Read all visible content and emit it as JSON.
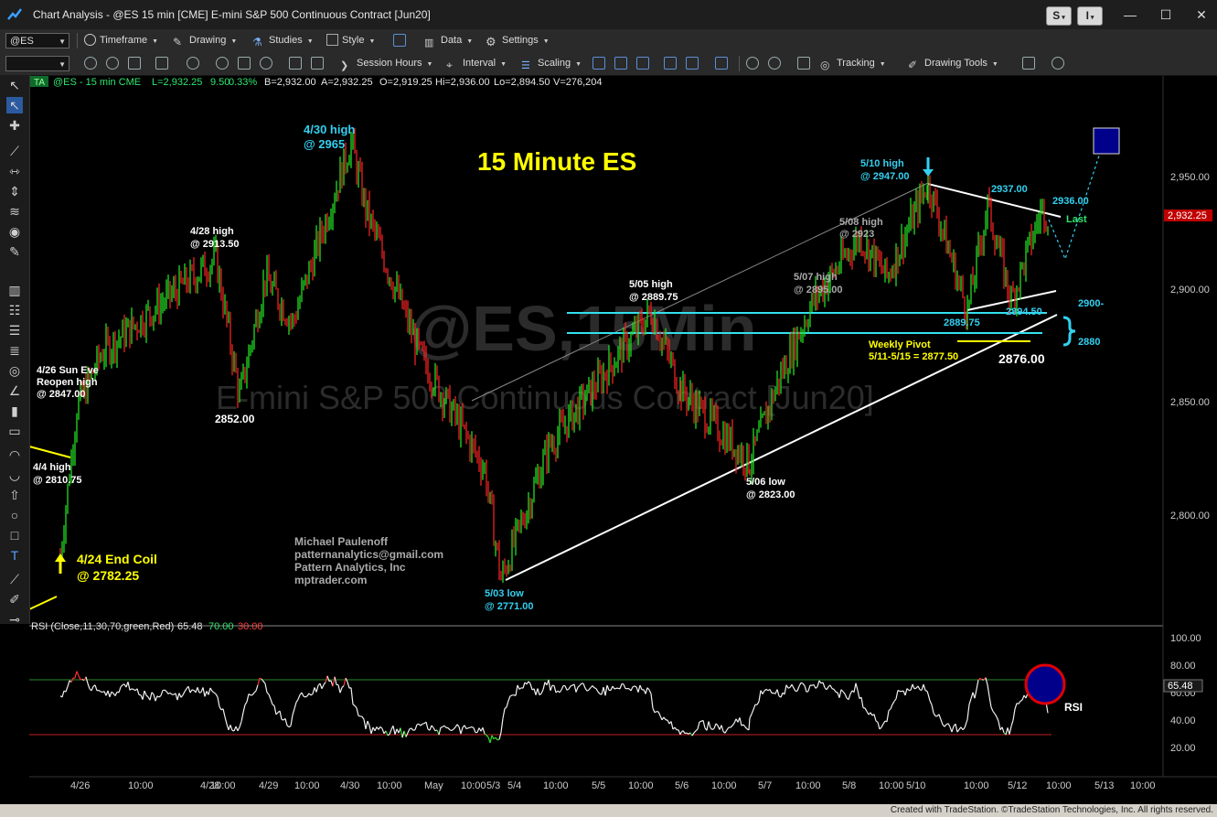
{
  "window": {
    "title": "Chart Analysis - @ES 15 min [CME] E-mini S&P 500 Continuous Contract [Jun20]",
    "btn_s": "S",
    "btn_i": "I"
  },
  "toolbar1": {
    "symbol": "@ES",
    "timeframe": "Timeframe",
    "drawing": "Drawing",
    "studies": "Studies",
    "style": "Style",
    "data": "Data",
    "settings": "Settings"
  },
  "toolbar2": {
    "session_hours": "Session Hours",
    "interval": "Interval",
    "scaling": "Scaling",
    "tracking": "Tracking",
    "drawing_tools": "Drawing Tools"
  },
  "header": {
    "badge": "TA",
    "symbol_info": "@ES - 15 min  CME",
    "last": "L=2,932.25",
    "change": "9.50",
    "pct": "0.33%",
    "bid": "B=2,932.00",
    "ask": "A=2,932.25",
    "open": "O=2,919.25",
    "high": "Hi=2,936.00",
    "low": "Lo=2,894.50",
    "volume": "V=276,204"
  },
  "watermark": {
    "symbol": "@ES,15Min",
    "name": "E-mini S&P 500 Continuous Contract [Jun20]"
  },
  "chart_title": "15 Minute ES",
  "annotations": {
    "apr30_high": [
      "4/30 high",
      "@ 2965"
    ],
    "apr28_high": [
      "4/28 high",
      "@ 2913.50"
    ],
    "apr26_sun": [
      "4/26 Sun Eve",
      "Reopen high",
      "@ 2847.00"
    ],
    "apr4_high": [
      "4/4 high",
      "@ 2810.75"
    ],
    "apr24_coil": [
      "4/24 End Coil",
      "@ 2782.25"
    ],
    "low_2852": "2852.00",
    "may3_low": [
      "5/03 low",
      "@ 2771.00"
    ],
    "may5_high": [
      "5/05 high",
      "@ 2889.75"
    ],
    "may6_low": [
      "5/06 low",
      "@ 2823.00"
    ],
    "may7_high": [
      "5/07 high",
      "@ 2895.00"
    ],
    "may8_high": [
      "5/08 high",
      "@ 2923"
    ],
    "may10_high": [
      "5/10 high",
      "@ 2947.00"
    ],
    "lvl_2937": "2937.00",
    "lvl_2936": "2936.00",
    "last_label": "Last",
    "lvl_2889": "2889.75",
    "lvl_2894": "2894.50",
    "lvl_2900": "2900-",
    "lvl_2880": "2880",
    "pivot": [
      "Weekly Pivot",
      "5/11-5/15 = 2877.50"
    ],
    "lvl_2876": "2876.00",
    "author": [
      "Michael Paulenoff",
      "patternanalytics@gmail.com",
      "Pattern Analytics, Inc",
      "mptrader.com"
    ]
  },
  "price_axis": {
    "ticks": [
      "2,950.00",
      "2,900.00",
      "2,850.00",
      "2,800.00"
    ],
    "last_tag": "2,932.25"
  },
  "rsi": {
    "label": "RSI (Close,11,30,70,green,Red)",
    "value": "65.48",
    "ob": "70.00",
    "os": "30.00",
    "ticks": [
      "100.00",
      "80.00",
      "60.00",
      "40.00",
      "20.00"
    ],
    "tag": "65.48",
    "callout": "RSI"
  },
  "time_axis": [
    "4/26",
    "10:00",
    "4/28",
    "10:00",
    "4/29",
    "10:00",
    "4/30",
    "10:00",
    "May",
    "10:00",
    "5/3",
    "5/4",
    "10:00",
    "5/5",
    "10:00",
    "5/6",
    "10:00",
    "5/7",
    "10:00",
    "5/8",
    "10:00",
    "5/10",
    "10:00",
    "5/12",
    "10:00",
    "5/13",
    "10:00"
  ],
  "statusbar": {
    "copyright": "Created with TradeStation. ©TradeStation Technologies, Inc. All rights reserved."
  },
  "chart_data": {
    "type": "line",
    "title": "15 Minute ES",
    "xlabel": "",
    "ylabel": "",
    "ylim": [
      2755,
      2995
    ],
    "x": [
      "4/24",
      "4/26",
      "4/27",
      "4/28",
      "4/28",
      "4/29",
      "4/29",
      "4/30",
      "4/30",
      "5/1",
      "5/1",
      "5/3",
      "5/4",
      "5/5",
      "5/5",
      "5/6",
      "5/6",
      "5/7",
      "5/8",
      "5/8",
      "5/10",
      "5/11",
      "5/11",
      "5/12",
      "5/12",
      "5/12"
    ],
    "series": [
      {
        "values": [
          2782.25,
          2847.0,
          2872.0,
          2913.5,
          2852.0,
          2905.0,
          2885.0,
          2965.0,
          2935.0,
          2870.0,
          2820.0,
          2771.0,
          2830.0,
          2889.75,
          2855.0,
          2823.0,
          2860.0,
          2895.0,
          2923.0,
          2905.0,
          2947.0,
          2889.75,
          2937.0,
          2894.5,
          2936.0,
          2932.25
        ]
      }
    ],
    "rsi_ylim": [
      10,
      110
    ]
  }
}
